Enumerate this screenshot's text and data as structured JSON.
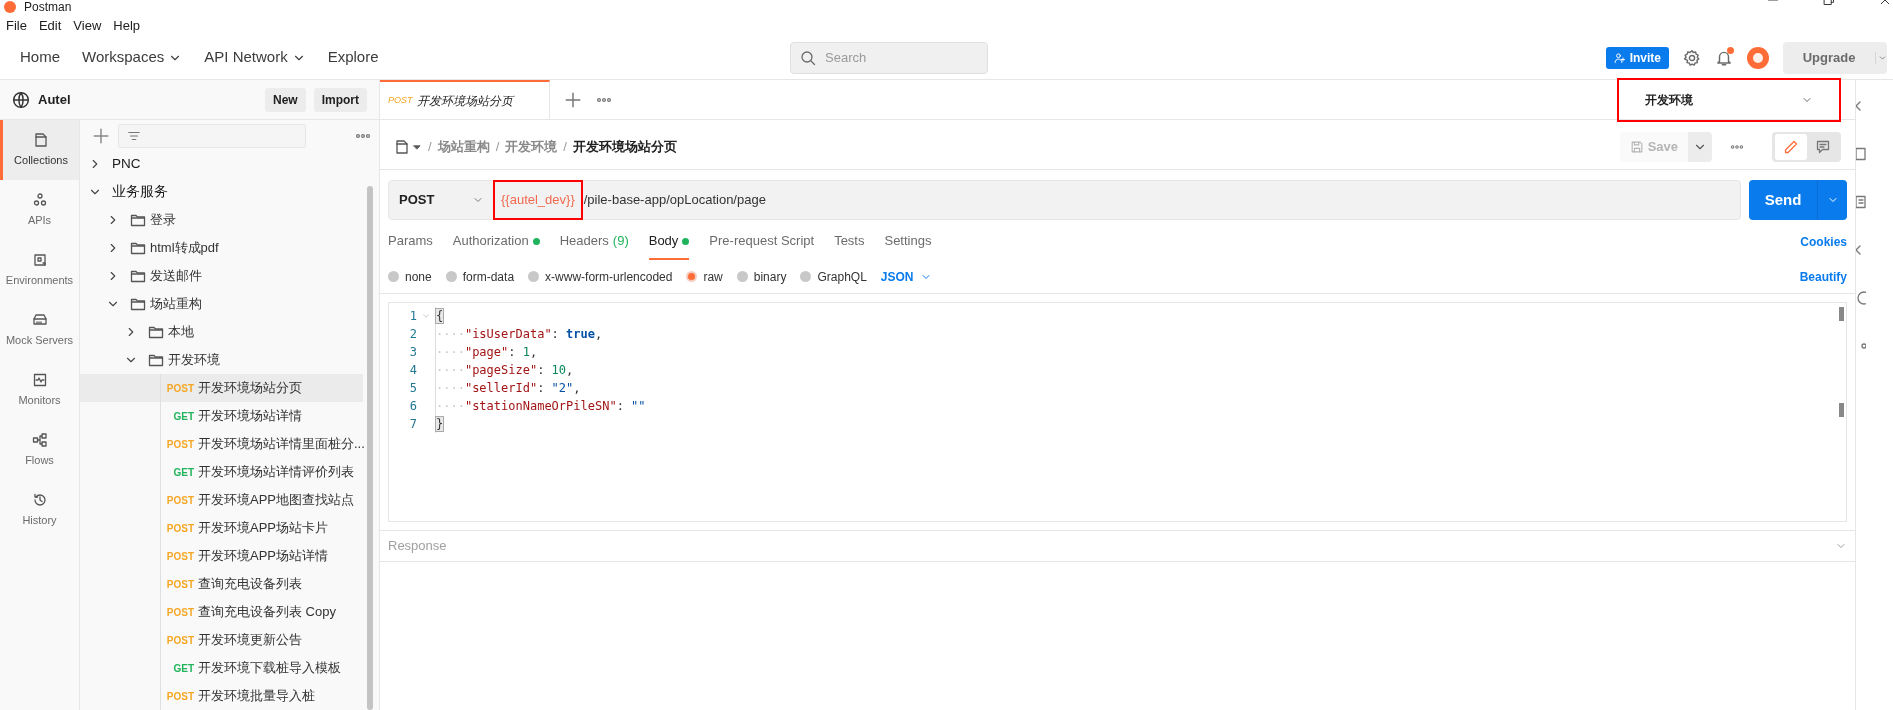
{
  "window": {
    "title": "Postman"
  },
  "menu": [
    "File",
    "Edit",
    "View",
    "Help"
  ],
  "nav": [
    {
      "label": "Home",
      "dropdown": false
    },
    {
      "label": "Workspaces",
      "dropdown": true
    },
    {
      "label": "API Network",
      "dropdown": true
    },
    {
      "label": "Explore",
      "dropdown": false
    }
  ],
  "search": {
    "placeholder": "Search"
  },
  "header_actions": {
    "invite": "Invite",
    "notification_unread": true,
    "upgrade": "Upgrade"
  },
  "workspace": {
    "name": "Autel",
    "new": "New",
    "import": "Import"
  },
  "rail": [
    {
      "label": "Collections",
      "kind": "collections",
      "selected": true
    },
    {
      "label": "APIs",
      "kind": "apis",
      "selected": false
    },
    {
      "label": "Environments",
      "kind": "environments",
      "selected": false
    },
    {
      "label": "Mock Servers",
      "kind": "mock",
      "selected": false
    },
    {
      "label": "Monitors",
      "kind": "monitors",
      "selected": false
    },
    {
      "label": "Flows",
      "kind": "flows",
      "selected": false
    },
    {
      "label": "History",
      "kind": "history",
      "selected": false
    }
  ],
  "tree": [
    {
      "kind": "collection",
      "label": "PNC",
      "expanded": false
    },
    {
      "kind": "collection",
      "label": "业务服务",
      "expanded": true,
      "children": [
        {
          "kind": "folder",
          "label": "登录",
          "expanded": false
        },
        {
          "kind": "folder",
          "label": "html转成pdf",
          "expanded": false
        },
        {
          "kind": "folder",
          "label": "发送邮件",
          "expanded": false
        },
        {
          "kind": "folder",
          "label": "场站重构",
          "expanded": true,
          "children": [
            {
              "kind": "folder",
              "label": "本地",
              "expanded": false
            },
            {
              "kind": "folder",
              "label": "开发环境",
              "expanded": true,
              "children": [
                {
                  "kind": "request",
                  "method": "POST",
                  "color": "#f5a623",
                  "label": "开发环境场站分页",
                  "selected": true
                },
                {
                  "kind": "request",
                  "method": "GET",
                  "color": "#1fb35b",
                  "label": "开发环境场站详情",
                  "selected": false
                },
                {
                  "kind": "request",
                  "method": "POST",
                  "color": "#f5a623",
                  "label": "开发环境场站详情里面桩分...",
                  "selected": false
                },
                {
                  "kind": "request",
                  "method": "GET",
                  "color": "#1fb35b",
                  "label": "开发环境场站详情评价列表",
                  "selected": false
                },
                {
                  "kind": "request",
                  "method": "POST",
                  "color": "#f5a623",
                  "label": "开发环境APP地图查找站点",
                  "selected": false
                },
                {
                  "kind": "request",
                  "method": "POST",
                  "color": "#f5a623",
                  "label": "开发环境APP场站卡片",
                  "selected": false
                },
                {
                  "kind": "request",
                  "method": "POST",
                  "color": "#f5a623",
                  "label": "开发环境APP场站详情",
                  "selected": false
                },
                {
                  "kind": "request",
                  "method": "POST",
                  "color": "#f5a623",
                  "label": "查询充电设备列表",
                  "selected": false
                },
                {
                  "kind": "request",
                  "method": "POST",
                  "color": "#f5a623",
                  "label": "查询充电设备列表 Copy",
                  "selected": false
                },
                {
                  "kind": "request",
                  "method": "POST",
                  "color": "#f5a623",
                  "label": "开发环境更新公告",
                  "selected": false
                },
                {
                  "kind": "request",
                  "method": "GET",
                  "color": "#1fb35b",
                  "label": "开发环境下载桩导入模板",
                  "selected": false
                },
                {
                  "kind": "request",
                  "method": "POST",
                  "color": "#f5a623",
                  "label": "开发环境批量导入桩",
                  "selected": false
                }
              ]
            }
          ]
        }
      ]
    }
  ],
  "open_tab": {
    "method": "POST",
    "title": "开发环境场站分页"
  },
  "environment": {
    "label": "开发环境",
    "highlighted": true
  },
  "breadcrumb_separator": "/",
  "breadcrumbs": [
    {
      "label": "场站重构",
      "current": false
    },
    {
      "label": "开发环境",
      "current": false
    },
    {
      "label": "开发环境场站分页",
      "current": true
    }
  ],
  "save": "Save",
  "request": {
    "method": "POST",
    "variable": "{{autel_dev}}",
    "variable_highlighted": true,
    "path": "/pile-base-app/opLocation/page",
    "send": "Send"
  },
  "request_tabs": [
    {
      "label": "Params",
      "selected": false,
      "dot": false
    },
    {
      "label": "Authorization",
      "selected": false,
      "dot": true
    },
    {
      "label": "Headers",
      "count": "(9)",
      "selected": false,
      "dot": false
    },
    {
      "label": "Body",
      "selected": true,
      "dot": true
    },
    {
      "label": "Pre-request Script",
      "selected": false,
      "dot": false
    },
    {
      "label": "Tests",
      "selected": false,
      "dot": false
    },
    {
      "label": "Settings",
      "selected": false,
      "dot": false
    }
  ],
  "cookies": "Cookies",
  "body_types": [
    {
      "label": "none",
      "selected": false
    },
    {
      "label": "form-data",
      "selected": false
    },
    {
      "label": "x-www-form-urlencoded",
      "selected": false
    },
    {
      "label": "raw",
      "selected": true
    },
    {
      "label": "binary",
      "selected": false
    },
    {
      "label": "GraphQL",
      "selected": false
    }
  ],
  "raw_format": "JSON",
  "beautify": "Beautify",
  "code": [
    {
      "number": "1",
      "tokens": [
        {
          "kind": "brace",
          "text": "{"
        }
      ]
    },
    {
      "number": "2",
      "tokens": [
        {
          "kind": "space",
          "text": "····"
        },
        {
          "kind": "key",
          "text": "\"isUserData\""
        },
        {
          "kind": "punct",
          "text": ": "
        },
        {
          "kind": "keyword",
          "text": "true"
        },
        {
          "kind": "punct",
          "text": ","
        }
      ]
    },
    {
      "number": "3",
      "tokens": [
        {
          "kind": "space",
          "text": "····"
        },
        {
          "kind": "key",
          "text": "\"page\""
        },
        {
          "kind": "punct",
          "text": ": "
        },
        {
          "kind": "number",
          "text": "1"
        },
        {
          "kind": "punct",
          "text": ","
        }
      ]
    },
    {
      "number": "4",
      "tokens": [
        {
          "kind": "space",
          "text": "····"
        },
        {
          "kind": "key",
          "text": "\"pageSize\""
        },
        {
          "kind": "punct",
          "text": ": "
        },
        {
          "kind": "number",
          "text": "10"
        },
        {
          "kind": "punct",
          "text": ","
        }
      ]
    },
    {
      "number": "5",
      "tokens": [
        {
          "kind": "space",
          "text": "····"
        },
        {
          "kind": "key",
          "text": "\"sellerId\""
        },
        {
          "kind": "punct",
          "text": ": "
        },
        {
          "kind": "string",
          "text": "\"2\""
        },
        {
          "kind": "punct",
          "text": ","
        }
      ]
    },
    {
      "number": "6",
      "tokens": [
        {
          "kind": "space",
          "text": "····"
        },
        {
          "kind": "key",
          "text": "\"stationNameOrPileSN\""
        },
        {
          "kind": "punct",
          "text": ": "
        },
        {
          "kind": "string",
          "text": "\"\""
        }
      ]
    },
    {
      "number": "7",
      "tokens": [
        {
          "kind": "brace",
          "text": "}"
        }
      ]
    }
  ],
  "response": {
    "label": "Response"
  }
}
